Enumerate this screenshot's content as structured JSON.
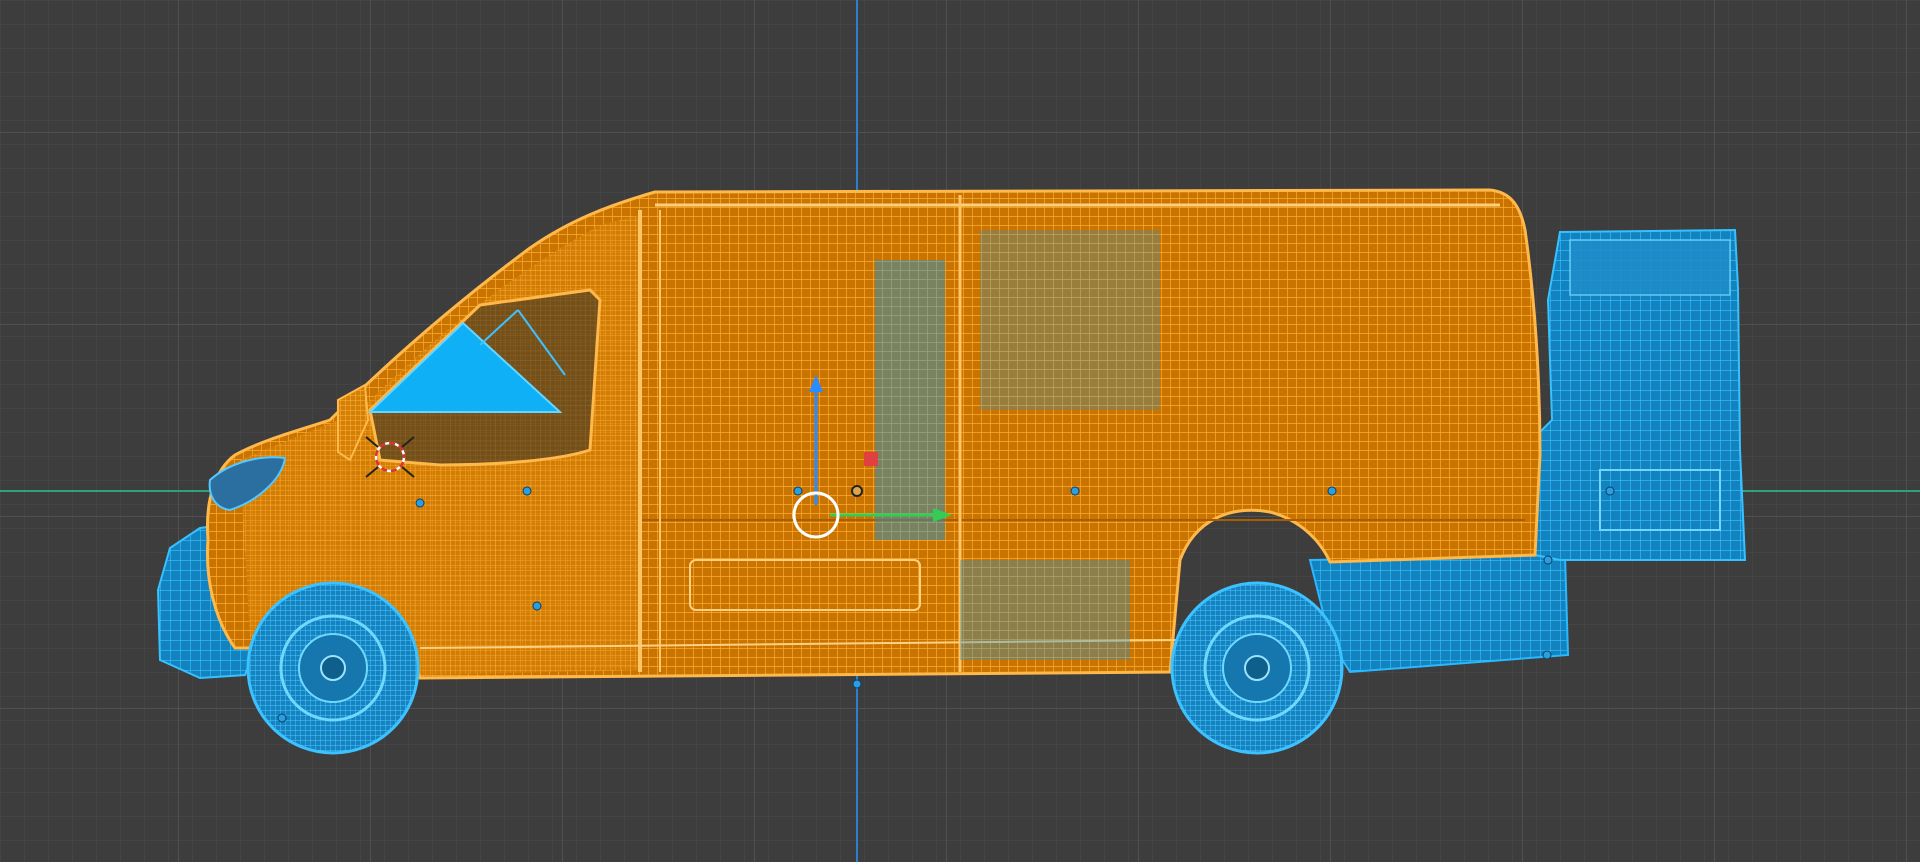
{
  "viewport": {
    "mode": "wireframe",
    "view": "side",
    "grid": true
  },
  "colors": {
    "background": "#3d3d3d",
    "grid_minor": "#4a4a4a",
    "grid_major": "#555555",
    "axis_x": "#2f9f7f",
    "axis_z": "#2a7fd0",
    "active_object": "#f5960a",
    "selected_object": "#1ea7e8",
    "gizmo_z": "#2a8cff",
    "gizmo_y": "#33cc55",
    "gizmo_x": "#e04040",
    "gizmo_center": "#ffffff"
  },
  "scene": {
    "objects": [
      {
        "name": "van-body",
        "state": "active"
      },
      {
        "name": "front-wheel",
        "state": "selected"
      },
      {
        "name": "rear-wheel",
        "state": "selected"
      },
      {
        "name": "front-bumper",
        "state": "selected"
      },
      {
        "name": "rear-door",
        "state": "selected"
      },
      {
        "name": "rear-fender",
        "state": "selected"
      },
      {
        "name": "side-window",
        "state": "selected"
      }
    ],
    "gizmo": {
      "type": "translate",
      "axes": [
        "z",
        "y",
        "x"
      ]
    }
  }
}
